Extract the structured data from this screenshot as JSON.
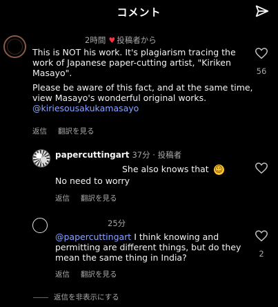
{
  "header": {
    "title": "コメント"
  },
  "comments": [
    {
      "time": "2時間",
      "badge": "投稿者から",
      "text_lines": [
        "This is NOT his work. It's plagiarism tracing the work of Japanese paper-cutting artist, \"Kiriken Masayo\".",
        "Please be aware of this fact, and at the same time, view Masayo's wonderful original works."
      ],
      "mention": "@kiriesousakukamasayo",
      "reply": "返信",
      "translate": "翻訳を見る",
      "likes": "56"
    },
    {
      "username": "papercuttingart",
      "time": "37分",
      "badge": "投稿者",
      "line1": "She also knows that",
      "emoji": "☺",
      "line2": "No need to worry",
      "reply": "返信",
      "translate": "翻訳を見る"
    },
    {
      "time": "25分",
      "mention": "@papercuttingart",
      "text": " I think knowing and permitting are different things, but do they mean the same thing in India?",
      "reply": "返信",
      "translate": "翻訳を見る",
      "likes": "2"
    }
  ],
  "hide_replies": "返信を非表示にする",
  "colors": {
    "heart": "#ff3040",
    "mention": "#8aa4ff",
    "emoji": "#f7c531"
  }
}
